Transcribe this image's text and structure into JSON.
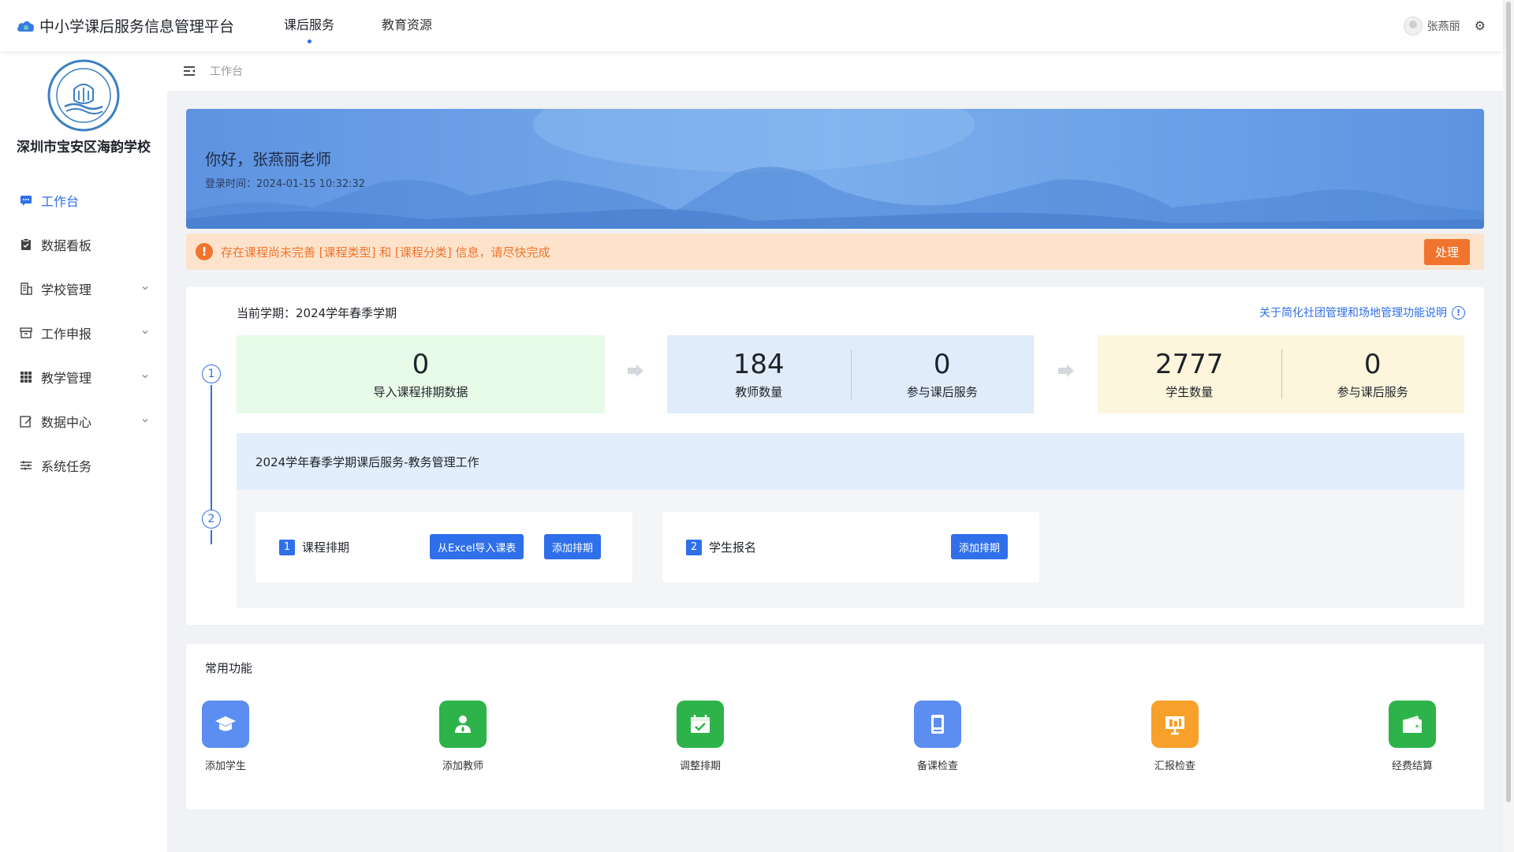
{
  "app": {
    "title": "中小学课后服务信息管理平台"
  },
  "topnav": [
    {
      "label": "课后服务",
      "active": true
    },
    {
      "label": "教育资源",
      "active": false
    }
  ],
  "user": {
    "name": "张燕丽"
  },
  "sidebar": {
    "school_name": "深圳市宝安区海韵学校",
    "items": [
      {
        "label": "工作台",
        "icon": "chat-icon",
        "active": true,
        "expandable": false
      },
      {
        "label": "数据看板",
        "icon": "clipboard-icon",
        "active": false,
        "expandable": false
      },
      {
        "label": "学校管理",
        "icon": "building-icon",
        "active": false,
        "expandable": true
      },
      {
        "label": "工作申报",
        "icon": "archive-icon",
        "active": false,
        "expandable": true
      },
      {
        "label": "教学管理",
        "icon": "grid-icon",
        "active": false,
        "expandable": true
      },
      {
        "label": "数据中心",
        "icon": "edit-icon",
        "active": false,
        "expandable": true
      },
      {
        "label": "系统任务",
        "icon": "sliders-icon",
        "active": false,
        "expandable": false
      }
    ]
  },
  "breadcrumb": {
    "current": "工作台"
  },
  "banner": {
    "greeting": "你好，张燕丽老师",
    "login_time": "登录时间：2024-01-15 10:32:32"
  },
  "alert": {
    "text": "存在课程尚未完善 [课程类型] 和 [课程分类] 信息，请尽快完成",
    "action_label": "处理",
    "icon_glyph": "!",
    "color": "#f0742d"
  },
  "semester": {
    "label": "当前学期：2024学年春季学期",
    "help_link": "关于简化社团管理和场地管理功能说明",
    "help_glyph": "!",
    "steps": [
      "1",
      "2"
    ],
    "stats": {
      "import": {
        "value": "0",
        "label": "导入课程排期数据"
      },
      "teachers": {
        "value": "184",
        "label": "教师数量"
      },
      "teachers_join": {
        "value": "0",
        "label": "参与课后服务"
      },
      "students": {
        "value": "2777",
        "label": "学生数量"
      },
      "students_join": {
        "value": "0",
        "label": "参与课后服务"
      }
    },
    "task_header": "2024学年春季学期课后服务-教务管理工作",
    "tasks": [
      {
        "num": "1",
        "title": "课程排期",
        "buttons": [
          "从Excel导入课表",
          "添加排期"
        ]
      },
      {
        "num": "2",
        "title": "学生报名",
        "buttons": [
          "添加排期"
        ]
      }
    ]
  },
  "common": {
    "title": "常用功能",
    "items": [
      {
        "label": "添加学生",
        "icon": "graduation-cap-icon",
        "color": "#5b8ef0"
      },
      {
        "label": "添加教师",
        "icon": "teacher-icon",
        "color": "#2db34a"
      },
      {
        "label": "调整排期",
        "icon": "calendar-check-icon",
        "color": "#2db34a"
      },
      {
        "label": "备课检查",
        "icon": "book-icon",
        "color": "#5b8ef0"
      },
      {
        "label": "汇报检查",
        "icon": "presentation-icon",
        "color": "#f7a02a"
      },
      {
        "label": "经费结算",
        "icon": "wallet-icon",
        "color": "#2db34a"
      }
    ]
  },
  "colors": {
    "primary": "#2f6fea",
    "green_box": "#e8fbe8",
    "blue_box": "#e0ecfa",
    "yellow_box": "#fdf5dc"
  }
}
